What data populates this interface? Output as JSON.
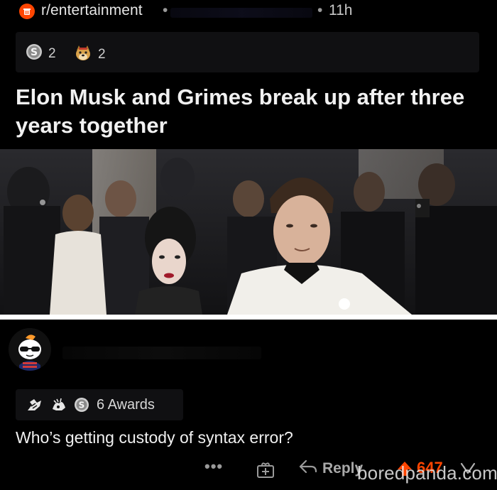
{
  "post": {
    "subreddit": "r/entertainment",
    "separator": "•",
    "time": "11h",
    "awards": [
      {
        "icon": "silver-award-icon",
        "count": "2"
      },
      {
        "icon": "doge-award-icon",
        "count": "2"
      }
    ],
    "title": "Elon Musk and Grimes break up after three years together"
  },
  "comment": {
    "awards_label": "6 Awards",
    "text": "Who’s getting custody of syntax error?",
    "actions": {
      "more": "•••",
      "reply_label": "Reply",
      "score": "647"
    }
  },
  "watermark": "boredpanda.com",
  "colors": {
    "background": "#000000",
    "accent": "#ff4500",
    "award_strip": "#101012"
  }
}
